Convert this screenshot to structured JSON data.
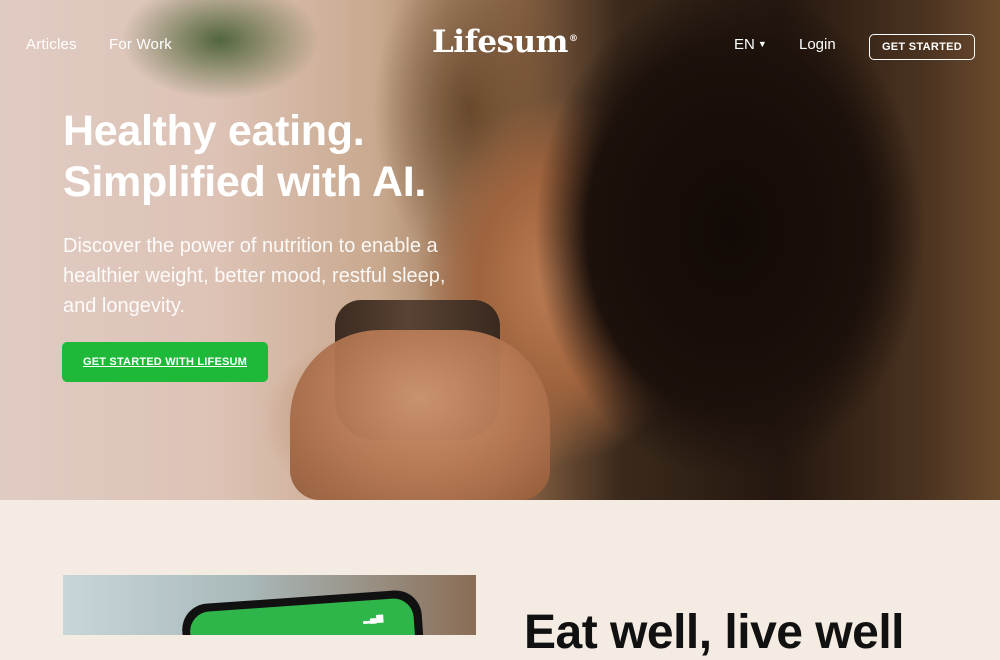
{
  "nav": {
    "links": [
      "Articles",
      "For Work"
    ],
    "logo": "Lifesum",
    "logo_mark": "®",
    "language": "EN",
    "login": "Login",
    "cta": "GET STARTED"
  },
  "hero": {
    "headline_line1": "Healthy eating.",
    "headline_line2": "Simplified with AI.",
    "subhead_line1": "Discover the power of nutrition to enable a",
    "subhead_line2": "healthier weight, better mood, restful sleep,",
    "subhead_line3": "and longevity.",
    "cta": "GET STARTED WITH LIFESUM"
  },
  "section": {
    "title": "Eat well, live well"
  },
  "colors": {
    "brand_green": "#1fb93a",
    "section_bg": "#f4ebe2",
    "text_light": "#ffffff"
  }
}
